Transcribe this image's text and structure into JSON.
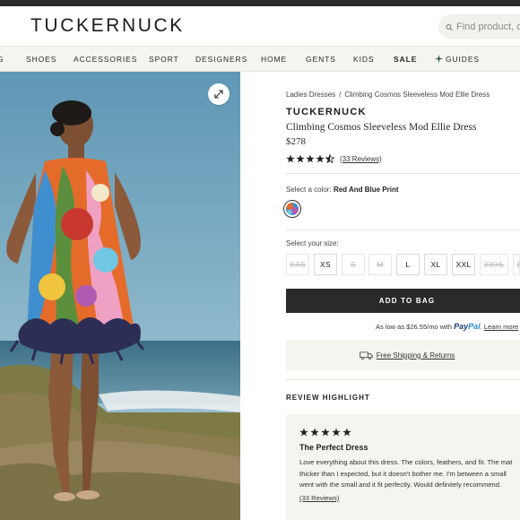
{
  "header": {
    "logo": "TUCKERNUCK",
    "search_placeholder": "Find product, c"
  },
  "nav": {
    "items": [
      "G",
      "SHOES",
      "ACCESSORIES",
      "SPORT",
      "DESIGNERS",
      "HOME",
      "GENTS",
      "KIDS",
      "SALE",
      "GUIDES"
    ]
  },
  "breadcrumb": {
    "items": [
      "Ladies Dresses",
      "Climbing Cosmos Sleeveless Mod Ellie Dress"
    ],
    "separator": "/"
  },
  "product": {
    "brand": "TUCKERNUCK",
    "name": "Climbing Cosmos Sleeveless Mod Ellie Dress",
    "price": "$278",
    "rating": 4.5,
    "reviews_link": "(33 Reviews)",
    "color_label": "Select a color:",
    "color_value": "Red And Blue Print",
    "size_label": "Select your size:",
    "sizes": [
      {
        "label": "XXS",
        "available": false
      },
      {
        "label": "XS",
        "available": true
      },
      {
        "label": "S",
        "available": false
      },
      {
        "label": "M",
        "available": false
      },
      {
        "label": "L",
        "available": true
      },
      {
        "label": "XL",
        "available": true
      },
      {
        "label": "XXL",
        "available": true
      },
      {
        "label": "XXXL",
        "available": false
      },
      {
        "label": "1",
        "available": false
      }
    ],
    "add_to_bag": "ADD TO BAG",
    "paypal_prefix": "As low as $26.55/mo with",
    "paypal_brand_a": "Pay",
    "paypal_brand_b": "Pal",
    "paypal_learn": "Learn more",
    "shipping": "Free Shipping & Returns"
  },
  "review_highlight": {
    "heading": "REVIEW HIGHLIGHT",
    "stars": 5,
    "title": "The Perfect Dress",
    "body_lines": [
      "Love everything about this dress. The colors, feathers, and fit. The mat",
      "thicker than I expected, but it doesn't bother me. I'm between a small",
      "went with the small and it fit perfectly. Would definitely recommend."
    ],
    "link": "(33 Reviews)"
  },
  "colors": {
    "nav_bg": "#f6f4ef",
    "button_bg": "#2a2a2a",
    "card_bg": "#f6f4ef"
  }
}
